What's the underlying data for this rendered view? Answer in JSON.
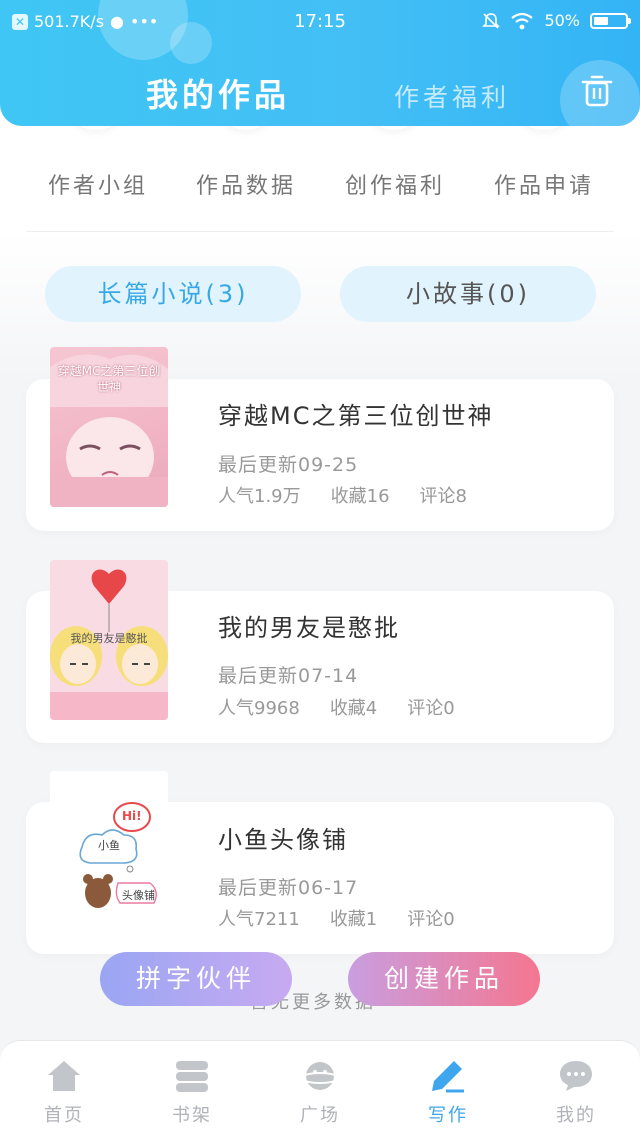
{
  "status_bar": {
    "net_speed": "501.7K/s",
    "dots": "•••",
    "time": "17:15",
    "battery": "50%"
  },
  "header": {
    "tab_active": "我的作品",
    "tab_inactive": "作者福利"
  },
  "quick_entries": [
    "作者小组",
    "作品数据",
    "创作福利",
    "作品申请"
  ],
  "categories": [
    {
      "label": "长篇小说(3)",
      "active": true
    },
    {
      "label": "小故事(0)",
      "active": false
    }
  ],
  "books": [
    {
      "title": "穿越MC之第三位创世神",
      "updated": "最后更新09-25",
      "popularity": "人气1.9万",
      "favorites": "收藏16",
      "comments": "评论8",
      "cover_text": "穿越MC之第三位创世神"
    },
    {
      "title": "我的男友是憨批",
      "updated": "最后更新07-14",
      "popularity": "人气9968",
      "favorites": "收藏4",
      "comments": "评论0",
      "cover_text": "我的男友是憨批"
    },
    {
      "title": "小鱼头像铺",
      "updated": "最后更新06-17",
      "popularity": "人气7211",
      "favorites": "收藏1",
      "comments": "评论0",
      "cover_text_a": "Hi!",
      "cover_text_b": "小鱼",
      "cover_text_c": "头像铺"
    }
  ],
  "more_hint": "暂无更多数据",
  "buttons": {
    "partner": "拼字伙伴",
    "create": "创建作品"
  },
  "nav": [
    {
      "label": "首页",
      "icon": "home-icon",
      "active": false
    },
    {
      "label": "书架",
      "icon": "bookshelf-icon",
      "active": false
    },
    {
      "label": "广场",
      "icon": "planet-icon",
      "active": false
    },
    {
      "label": "写作",
      "icon": "pen-icon",
      "active": true
    },
    {
      "label": "我的",
      "icon": "chat-bubble-icon",
      "active": false
    }
  ],
  "colors": {
    "header": "#3fc6f4",
    "accent": "#3ea6ec",
    "pill": "#e1f3fd"
  }
}
